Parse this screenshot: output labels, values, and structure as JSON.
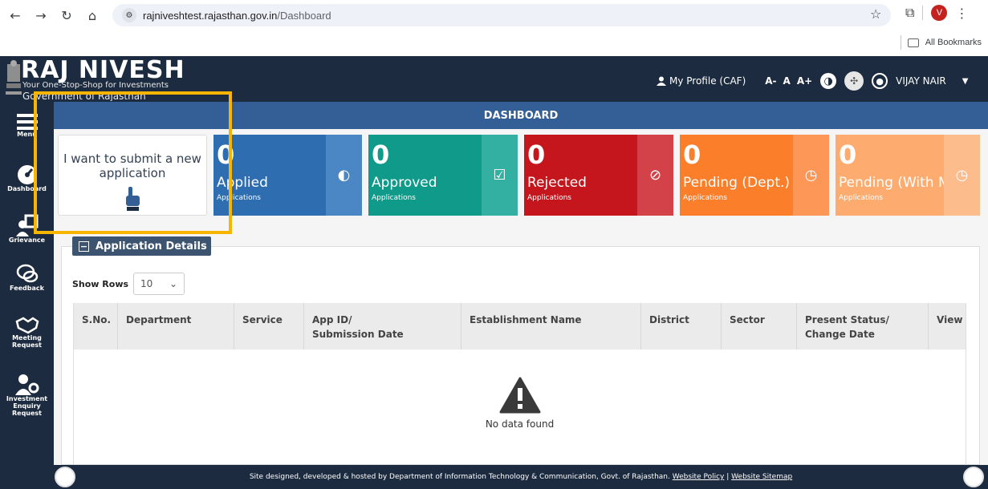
{
  "browser": {
    "url_host": "rajniveshtest.rajasthan.gov.in",
    "url_path": "/Dashboard",
    "profile_initial": "V",
    "bookmarks_label": "All Bookmarks"
  },
  "header": {
    "title": "RAJ NIVESH",
    "tagline": "Your One-Stop-Shop for Investments",
    "government": "Government of Rajasthan",
    "my_profile": "My Profile (CAF)",
    "font_small": "A-",
    "font_normal": "A",
    "font_large": "A+",
    "user_name": "VIJAY NAIR"
  },
  "sidebar": {
    "items": [
      {
        "label": "Menu",
        "icon": "menu-icon"
      },
      {
        "label": "Dashboard",
        "icon": "gauge-icon"
      },
      {
        "label": "Grievance",
        "icon": "grievance-icon"
      },
      {
        "label": "Feedback",
        "icon": "chat-icon"
      },
      {
        "label": "Meeting Request",
        "icon": "handshake-icon"
      },
      {
        "label": "Investment Enquiry Request",
        "icon": "user-gear-icon"
      }
    ]
  },
  "dashboard": {
    "title": "DASHBOARD",
    "submit_card": "I want to submit a new application",
    "tiles": [
      {
        "count": "0",
        "label": "Applied",
        "sub": "Applications",
        "color": "#2e6daf",
        "side": "#4a87c4"
      },
      {
        "count": "0",
        "label": "Approved",
        "sub": "Applications",
        "color": "#0f9a8a",
        "side": "#34b0a3"
      },
      {
        "count": "0",
        "label": "Rejected",
        "sub": "Applications",
        "color": "#c4161c",
        "side": "#d24248"
      },
      {
        "count": "0",
        "label": "Pending (Dept.)",
        "sub": "Applications",
        "color": "#fb7e2a",
        "side": "#fc9757"
      },
      {
        "count": "0",
        "label": "Pending (With Me)",
        "sub": "Applications",
        "color": "#fdab6e",
        "side": "#fdbc8c"
      }
    ]
  },
  "details": {
    "title": "Application Details",
    "show_rows_label": "Show Rows",
    "rows_value": "10",
    "columns": [
      {
        "l1": "S.No.",
        "l2": ""
      },
      {
        "l1": "Department",
        "l2": ""
      },
      {
        "l1": "Service",
        "l2": ""
      },
      {
        "l1": "App ID/",
        "l2": "Submission Date"
      },
      {
        "l1": "Establishment Name",
        "l2": ""
      },
      {
        "l1": "District",
        "l2": ""
      },
      {
        "l1": "Sector",
        "l2": ""
      },
      {
        "l1": "Present Status/",
        "l2": "Change Date"
      },
      {
        "l1": "View",
        "l2": ""
      }
    ],
    "empty_message": "No data found"
  },
  "footer": {
    "text": "Site designed, developed & hosted by Department of Information Technology & Communication, Govt. of Rajasthan.",
    "policy_link": "Website Policy",
    "divider": "|",
    "sitemap_link": "Website Sitemap"
  }
}
